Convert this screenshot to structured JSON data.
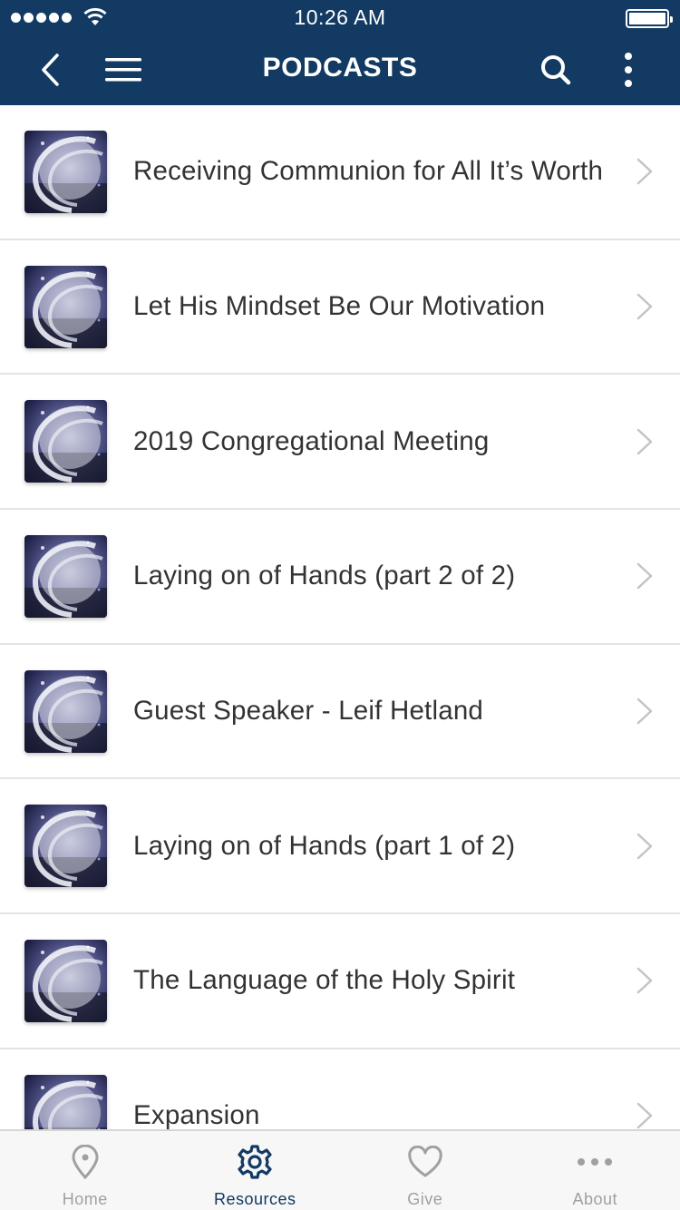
{
  "status_bar": {
    "time": "10:26 AM"
  },
  "nav": {
    "title": "PODCASTS",
    "back_icon": "chevron-left-icon",
    "menu_icon": "hamburger-icon",
    "search_icon": "search-icon",
    "more_icon": "more-vertical-icon"
  },
  "podcasts": [
    {
      "title": "Receiving Communion for All It’s Worth"
    },
    {
      "title": "Let His Mindset Be Our Motivation"
    },
    {
      "title": "2019 Congregational Meeting"
    },
    {
      "title": "Laying on of Hands (part 2 of 2)"
    },
    {
      "title": "Guest Speaker - Leif Hetland"
    },
    {
      "title": "Laying on of Hands (part 1 of 2)"
    },
    {
      "title": "The Language of the Holy Spirit"
    },
    {
      "title": "Expansion"
    }
  ],
  "tabs": [
    {
      "label": "Home",
      "icon": "map-pin-icon"
    },
    {
      "label": "Resources",
      "icon": "gear-icon"
    },
    {
      "label": "Give",
      "icon": "heart-icon"
    },
    {
      "label": "About",
      "icon": "ellipsis-icon"
    }
  ],
  "colors": {
    "header_bg": "#123a62",
    "active_tab": "#123a62",
    "inactive_tab": "#a0a0a0",
    "row_text": "#333333",
    "divider": "#e4e4e4"
  }
}
